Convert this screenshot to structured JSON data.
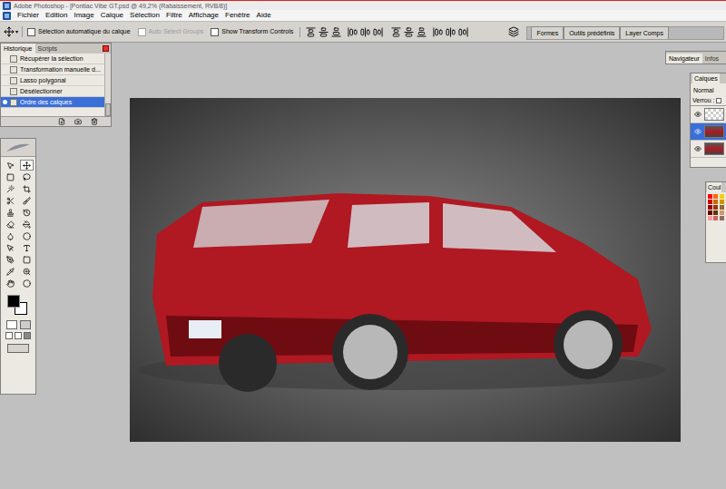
{
  "window": {
    "title": "Adobe Photoshop - [Pontiac Vibe GT.psd @ 49,2% (Rabaissement, RVB/8)]"
  },
  "menu": [
    "Fichier",
    "Edition",
    "Image",
    "Calque",
    "Sélection",
    "Filtre",
    "Affichage",
    "Fenêtre",
    "Aide"
  ],
  "options_bar": {
    "checkboxes": [
      {
        "label": "Sélection automatique du calque",
        "checked": false,
        "disabled": false
      },
      {
        "label": "Auto Select Groups",
        "checked": false,
        "disabled": true
      },
      {
        "label": "Show Transform Controls",
        "checked": false,
        "disabled": false
      }
    ],
    "palette_well": [
      {
        "label": "Formes",
        "selected": false
      },
      {
        "label": "Outils prédéfinis",
        "selected": false
      },
      {
        "label": "Layer Comps",
        "selected": false
      }
    ]
  },
  "history_panel": {
    "tabs": [
      {
        "label": "Historique",
        "selected": true
      },
      {
        "label": "Scripts",
        "selected": false
      }
    ],
    "items": [
      {
        "label": "Récupérer la sélection",
        "selected": false
      },
      {
        "label": "Transformation manuelle d...",
        "selected": false
      },
      {
        "label": "Lasso polygonal",
        "selected": false
      },
      {
        "label": "Désélectionner",
        "selected": false
      },
      {
        "label": "Ordre des calques",
        "selected": true
      }
    ]
  },
  "toolbox": {
    "foreground": "#000000",
    "background": "#ffffff"
  },
  "navigator_panel": {
    "tabs": [
      {
        "label": "Navigateur",
        "selected": true
      },
      {
        "label": "Infos",
        "selected": false
      }
    ]
  },
  "layers_panel": {
    "tab": "Calques",
    "blend_mode": "Normal",
    "lock_label": "Verrou :",
    "layers": [
      {
        "kind": "transparent",
        "visible": true,
        "selected": false
      },
      {
        "kind": "image",
        "visible": true,
        "selected": true
      },
      {
        "kind": "image",
        "visible": true,
        "selected": false
      }
    ]
  },
  "swatches_panel": {
    "tab": "Coul",
    "colors": [
      "#ff0000",
      "#ff6600",
      "#ffcc00",
      "#cc0000",
      "#cc6600",
      "#cc9900",
      "#990000",
      "#993300",
      "#996633",
      "#660000",
      "#663300",
      "#cc9966",
      "#ff9999",
      "#cc6666",
      "#996666"
    ]
  }
}
